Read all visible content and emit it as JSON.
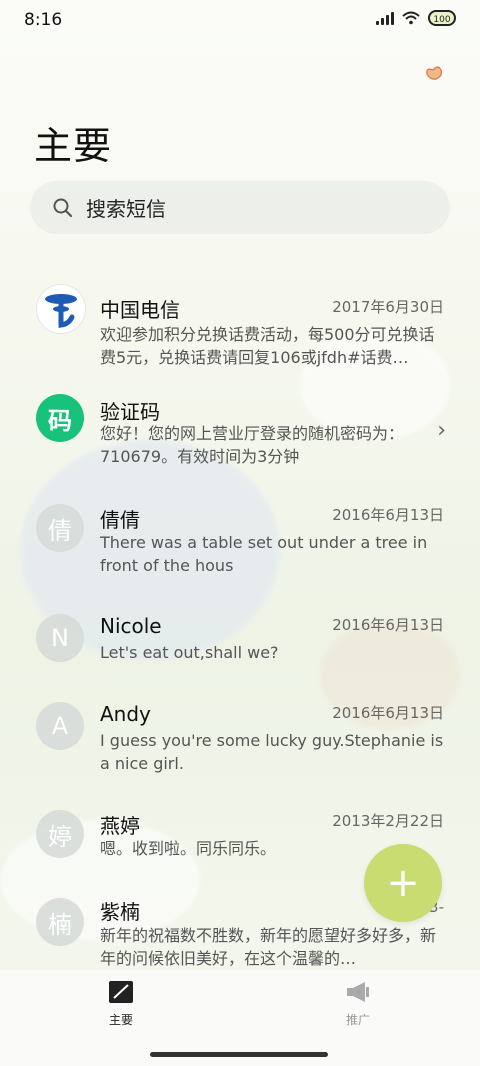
{
  "status_bar": {
    "time": "8:16",
    "battery": "100"
  },
  "page_title": "主要",
  "search": {
    "placeholder": "搜索短信"
  },
  "conversations": [
    {
      "name": "中国电信",
      "date": "2017年6月30日",
      "preview": "欢迎参加积分兑换话费活动，每500分可兑换话费5元，兑换话费请回复106或jfdh#话费…",
      "avatar": ""
    },
    {
      "name": "验证码",
      "date": "",
      "preview": "您好！您的网上营业厅登录的随机密码为：710679。有效时间为3分钟",
      "avatar": "码"
    },
    {
      "name": "倩倩",
      "date": "2016年6月13日",
      "preview": "There was a table set out under a tree in front of the hous",
      "avatar": "倩"
    },
    {
      "name": "Nicole",
      "date": "2016年6月13日",
      "preview": "Let's eat out,shall we?",
      "avatar": "N"
    },
    {
      "name": "Andy",
      "date": "2016年6月13日",
      "preview": "I guess you're some lucky guy.Stephanie is a nice girl.",
      "avatar": "A"
    },
    {
      "name": "燕婷",
      "date": "2013年2月22日",
      "preview": "嗯。收到啦。同乐同乐。",
      "avatar": "婷"
    },
    {
      "name": "紫楠",
      "date": "2013-",
      "preview": "新年的祝福数不胜数，新年的愿望好多好多，新年的问候依旧美好，在这个温馨的…",
      "avatar": "楠"
    }
  ],
  "fab": {
    "label": "+"
  },
  "bottom_nav": [
    {
      "label": "主要",
      "icon": "compose-icon"
    },
    {
      "label": "推广",
      "icon": "megaphone-icon"
    }
  ],
  "colors": {
    "accent": "#c9dc71",
    "verify_green": "#18c27a"
  }
}
